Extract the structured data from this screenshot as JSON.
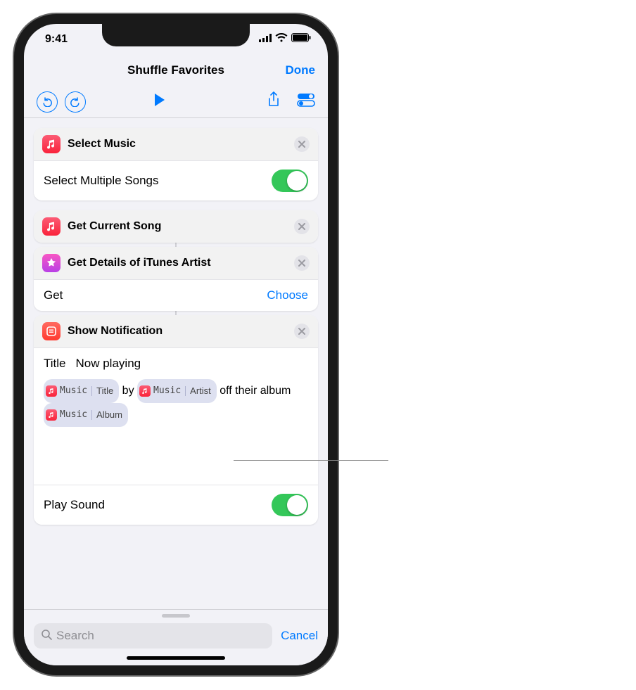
{
  "status": {
    "time": "9:41"
  },
  "nav": {
    "title": "Shuffle Favorites",
    "done": "Done"
  },
  "actions": {
    "select_music": {
      "title": "Select Music",
      "row_label": "Select Multiple Songs"
    },
    "get_current": {
      "title": "Get Current Song"
    },
    "itunes_artist": {
      "title": "Get Details of iTunes Artist",
      "row_label": "Get",
      "choose": "Choose"
    },
    "notification": {
      "title": "Show Notification",
      "title_field_label": "Title",
      "title_field_value": "Now playing",
      "body": {
        "t1": {
          "source": "Music",
          "key": "Title"
        },
        "tx1": " by ",
        "t2": {
          "source": "Music",
          "key": "Artist"
        },
        "tx2": " off their album ",
        "t3": {
          "source": "Music",
          "key": "Album"
        }
      },
      "play_sound_label": "Play Sound"
    }
  },
  "search": {
    "placeholder": "Search",
    "cancel": "Cancel"
  }
}
